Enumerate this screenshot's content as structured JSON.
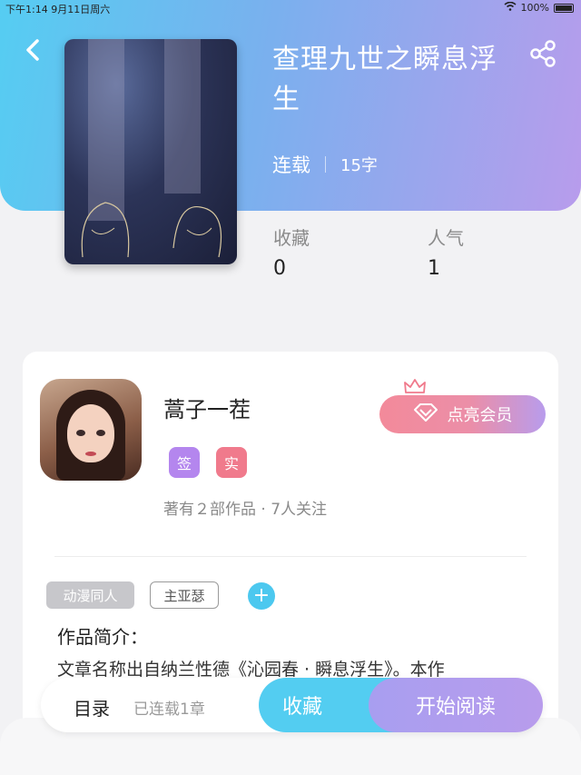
{
  "status_bar": {
    "time": "下午1:14",
    "date": "9月11日周六",
    "battery": "100%"
  },
  "book": {
    "title": "查理九世之瞬息浮生",
    "status": "连载",
    "word_count": "15字",
    "stats": [
      {
        "label": "收藏",
        "value": "0"
      },
      {
        "label": "人气",
        "value": "1"
      }
    ]
  },
  "author": {
    "name": "蒿子一茬",
    "badges": [
      "签",
      "实"
    ],
    "summary": "著有２部作品 · 7人关注",
    "vip_button": "点亮会员"
  },
  "tags": [
    "动漫同人",
    "主亚瑟"
  ],
  "intro": {
    "title": "作品简介：",
    "text": "文章名称出自纳兰性德《沁园春 · 瞬息浮生》。本作"
  },
  "bottom_bar": {
    "toc": "目录",
    "chapters": "已连载1章",
    "favorite": "收藏",
    "read": "开始阅读"
  },
  "colors": {
    "accent_blue": "#53cdf1",
    "accent_purple": "#b89cec",
    "badge_pink": "#f07a8c"
  }
}
